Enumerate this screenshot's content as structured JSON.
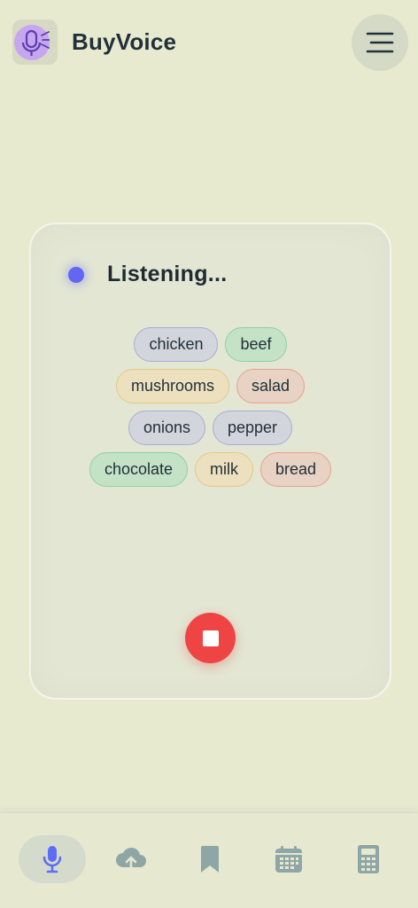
{
  "header": {
    "app_title": "BuyVoice",
    "logo_icon": "microphone-sound-icon",
    "menu_icon": "hamburger-menu-icon"
  },
  "listening": {
    "status_text": "Listening...",
    "accent_color": "#6366f1",
    "stop_color": "#ef4444"
  },
  "tags": [
    [
      {
        "label": "chicken",
        "bg": "#d3d5dc",
        "border": "#a9acd8"
      },
      {
        "label": "beef",
        "bg": "#c4e2c6",
        "border": "#8ed1a2"
      }
    ],
    [
      {
        "label": "mushrooms",
        "bg": "#ece0bf",
        "border": "#e4c983"
      },
      {
        "label": "salad",
        "bg": "#e7d2c3",
        "border": "#e9a08f"
      }
    ],
    [
      {
        "label": "onions",
        "bg": "#d3d5dc",
        "border": "#a9acd8"
      },
      {
        "label": "pepper",
        "bg": "#d3d5dc",
        "border": "#a9acd8"
      }
    ],
    [
      {
        "label": "chocolate",
        "bg": "#c4e2c6",
        "border": "#8ed1a2"
      },
      {
        "label": "milk",
        "bg": "#ece0bf",
        "border": "#e4c983"
      },
      {
        "label": "bread",
        "bg": "#e7d2c3",
        "border": "#e9a08f"
      }
    ]
  ],
  "nav": {
    "items": [
      {
        "icon": "microphone-icon",
        "active": true
      },
      {
        "icon": "cloud-upload-icon",
        "active": false
      },
      {
        "icon": "bookmark-icon",
        "active": false
      },
      {
        "icon": "calendar-icon",
        "active": false
      },
      {
        "icon": "calculator-icon",
        "active": false
      }
    ]
  }
}
